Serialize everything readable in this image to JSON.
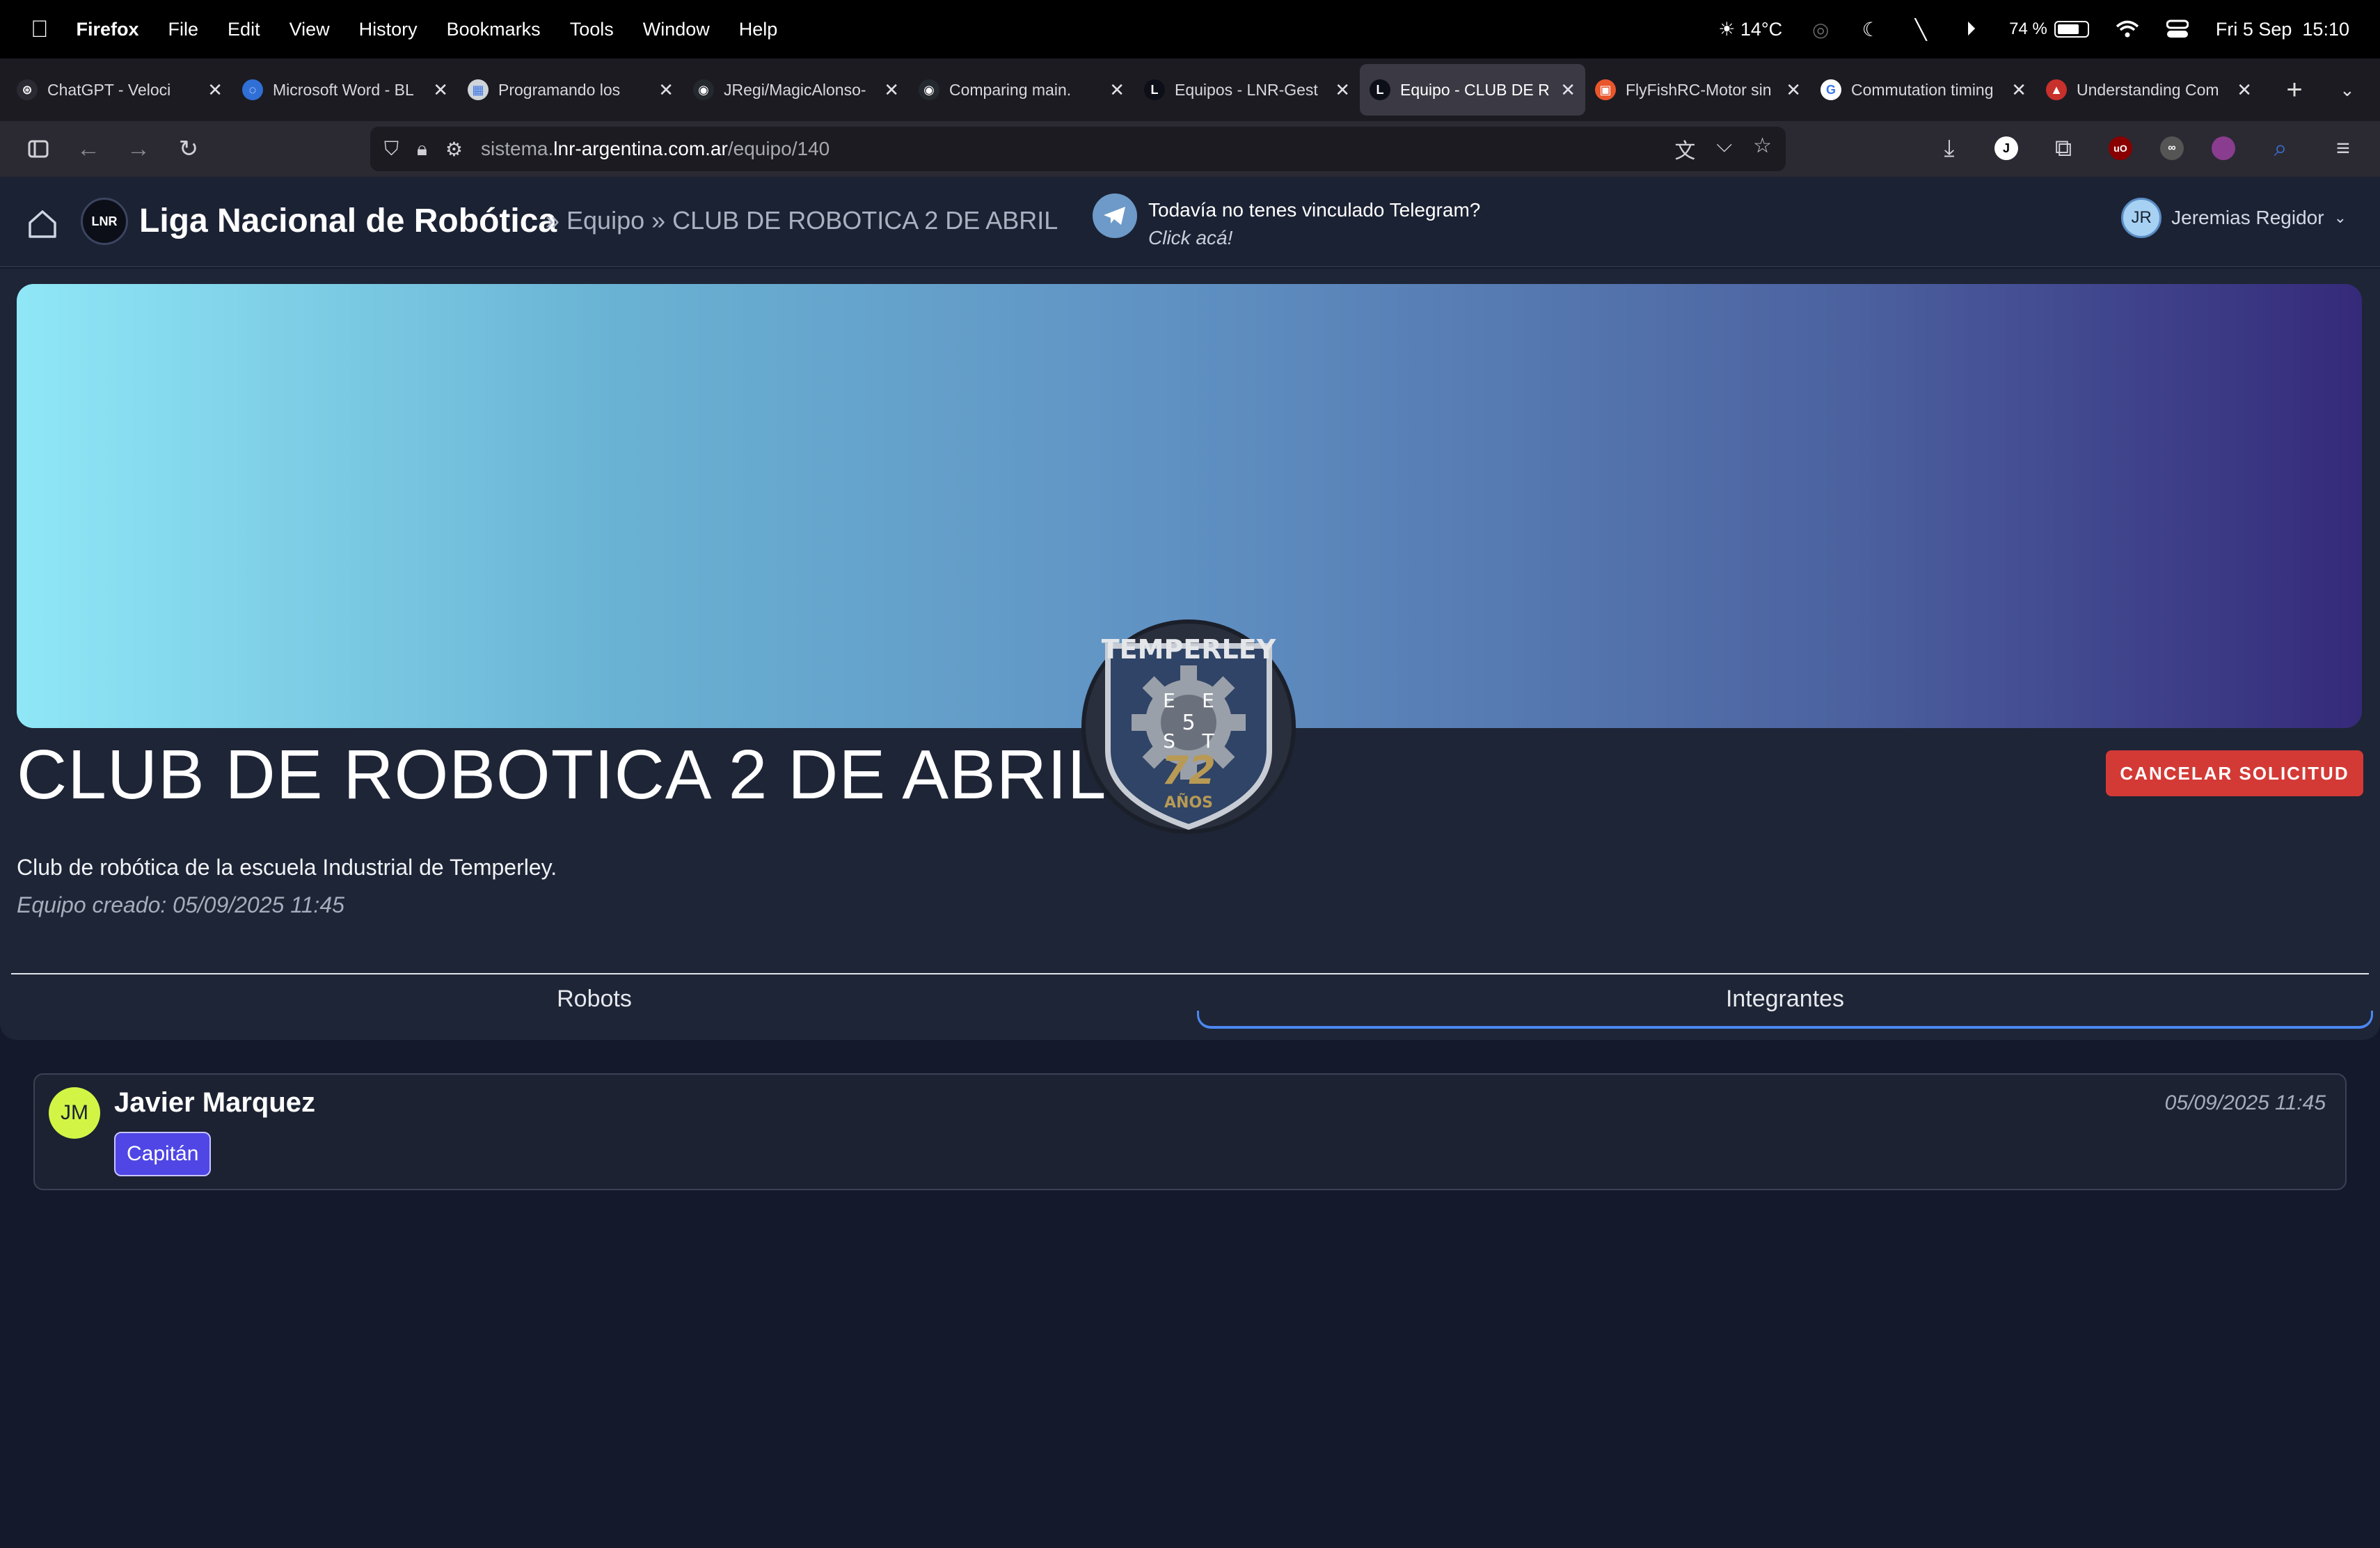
{
  "menubar": {
    "app": "Firefox",
    "items": [
      "File",
      "Edit",
      "View",
      "History",
      "Bookmarks",
      "Tools",
      "Window",
      "Help"
    ],
    "weather": "14°C",
    "battery": "74 %",
    "battery_level": 0.74,
    "datetime": "Fri 5 Sep  15:10"
  },
  "tabs": [
    {
      "label": "ChatGPT - Veloci",
      "fav_color": "#2b2a33",
      "fav_text": "⊛"
    },
    {
      "label": "Microsoft Word - BL",
      "fav_color": "#2f6fd6",
      "fav_text": "◌"
    },
    {
      "label": "Programando los",
      "fav_color": "#cfd3da",
      "fav_text": "▦"
    },
    {
      "label": "JRegi/MagicAlonso-",
      "fav_color": "#24292f",
      "fav_text": "◉"
    },
    {
      "label": "Comparing main.",
      "fav_color": "#24292f",
      "fav_text": "◉"
    },
    {
      "label": "Equipos - LNR-Gest",
      "fav_color": "#0c0f18",
      "fav_text": "L"
    },
    {
      "label": "Equipo - CLUB DE R",
      "fav_color": "#0c0f18",
      "fav_text": "L",
      "active": true
    },
    {
      "label": "FlyFishRC-Motor sin",
      "fav_color": "#e9562c",
      "fav_text": "▣"
    },
    {
      "label": "Commutation timing",
      "fav_color": "#ffffff",
      "fav_text": "G"
    },
    {
      "label": "Understanding Com",
      "fav_color": "#c8302c",
      "fav_text": "▲"
    }
  ],
  "url": {
    "prefix": "sistema.",
    "host": "lnr-argentina.com.ar",
    "path": "/equipo/140"
  },
  "header": {
    "logo_text": "LNR",
    "brand": "Liga Nacional de Robótica",
    "breadcrumb": "» Equipo » CLUB DE ROBOTICA 2 DE ABRIL",
    "telegram_line1": "Todavía no tenes vinculado Telegram?",
    "telegram_line2": "Click acá!",
    "user_initials": "JR",
    "user_name": "Jeremias Regidor"
  },
  "team": {
    "name": "CLUB DE ROBOTICA 2 DE ABRIL",
    "cancel_label": "CANCELAR SOLICITUD",
    "description": "Club de robótica de la escuela Industrial de Temperley.",
    "created": "Equipo creado: 05/09/2025 11:45",
    "emblem_top": "TEMPERLEY",
    "emblem_letters": [
      "E",
      "E",
      "S",
      "T",
      "5"
    ],
    "emblem_years": "72",
    "emblem_sub": "AÑOS"
  },
  "content_tabs": {
    "robots": "Robots",
    "members": "Integrantes"
  },
  "members": [
    {
      "initials": "JM",
      "name": "Javier Marquez",
      "role": "Capitán",
      "date": "05/09/2025 11:45"
    }
  ]
}
